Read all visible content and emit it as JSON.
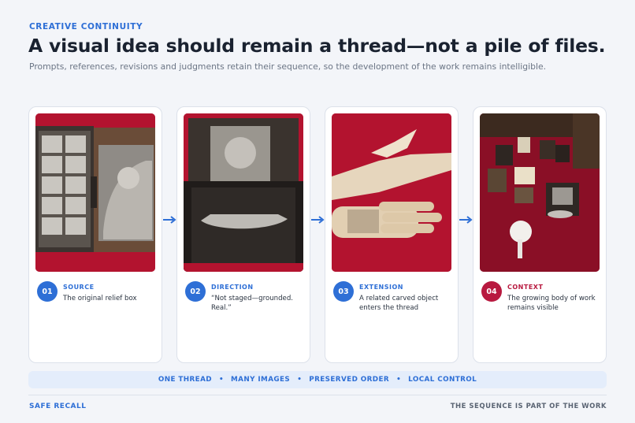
{
  "header": {
    "eyebrow": "CREATIVE CONTINUITY",
    "headline": "A visual idea should remain a thread—not a pile of files.",
    "subline": "Prompts, references, revisions and judgments retain their sequence, so the development of the work remains intelligible."
  },
  "steps": [
    {
      "number": "01",
      "label": "SOURCE",
      "description": "The original relief box",
      "accent": "#2e6fd6"
    },
    {
      "number": "02",
      "label": "DIRECTION",
      "description": "“Not staged—grounded. Real.”",
      "accent": "#2e6fd6"
    },
    {
      "number": "03",
      "label": "EXTENSION",
      "description": "A related carved object enters the thread",
      "accent": "#2e6fd6"
    },
    {
      "number": "04",
      "label": "CONTEXT",
      "description": "The growing body of work remains visible",
      "accent": "#b8193f"
    }
  ],
  "principles": [
    "ONE THREAD",
    "MANY IMAGES",
    "PRESERVED ORDER",
    "LOCAL CONTROL"
  ],
  "footer": {
    "left": "SAFE RECALL",
    "right": "THE SEQUENCE IS PART OF THE WORK"
  },
  "colors": {
    "accent": "#2e6fd6",
    "context_accent": "#b8193f",
    "background": "#f3f5f9"
  }
}
